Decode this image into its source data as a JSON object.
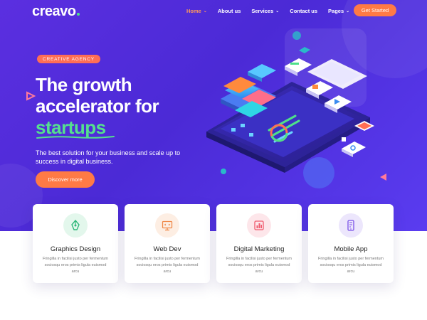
{
  "header": {
    "logo": "creavo",
    "nav": [
      {
        "label": "Home",
        "has_dropdown": true,
        "active": true
      },
      {
        "label": "About us",
        "has_dropdown": false,
        "active": false
      },
      {
        "label": "Services",
        "has_dropdown": true,
        "active": false
      },
      {
        "label": "Contact us",
        "has_dropdown": false,
        "active": false
      },
      {
        "label": "Pages",
        "has_dropdown": true,
        "active": false
      }
    ],
    "cta": "Get Started"
  },
  "hero": {
    "badge": "CREATIVE AGENCY",
    "headline_line1": "The growth",
    "headline_line2": "accelerator for",
    "headline_highlight": "startups",
    "subtext": "The best solution for your business and scale up to success in digital business.",
    "button": "Discover more"
  },
  "services": [
    {
      "title": "Graphics Design",
      "desc": "Fringilla in facilisi justo per fermentum sociosqu eros primis ligula euismod arcu",
      "icon": "pen-tool-icon",
      "color": "#2fb87a",
      "bg": "#e3f7ec"
    },
    {
      "title": "Web Dev",
      "desc": "Fringilla in facilisi justo per fermentum sociosqu eros primis ligula euismod arcu",
      "icon": "monitor-icon",
      "color": "#f08a4b",
      "bg": "#fdeee3"
    },
    {
      "title": "Digital Marketing",
      "desc": "Fringilla in facilisi justo per fermentum sociosqu eros primis ligula euismod arcu",
      "icon": "bar-chart-icon",
      "color": "#f05a6e",
      "bg": "#fde6ea"
    },
    {
      "title": "Mobile App",
      "desc": "Fringilla in facilisi justo per fermentum sociosqu eros primis ligula euismod arcu",
      "icon": "mobile-app-icon",
      "color": "#7a52e8",
      "bg": "#ece6fc"
    }
  ],
  "colors": {
    "hero_bg": "#4b2ad6",
    "accent": "#ff7a45",
    "highlight": "#55e08e"
  }
}
